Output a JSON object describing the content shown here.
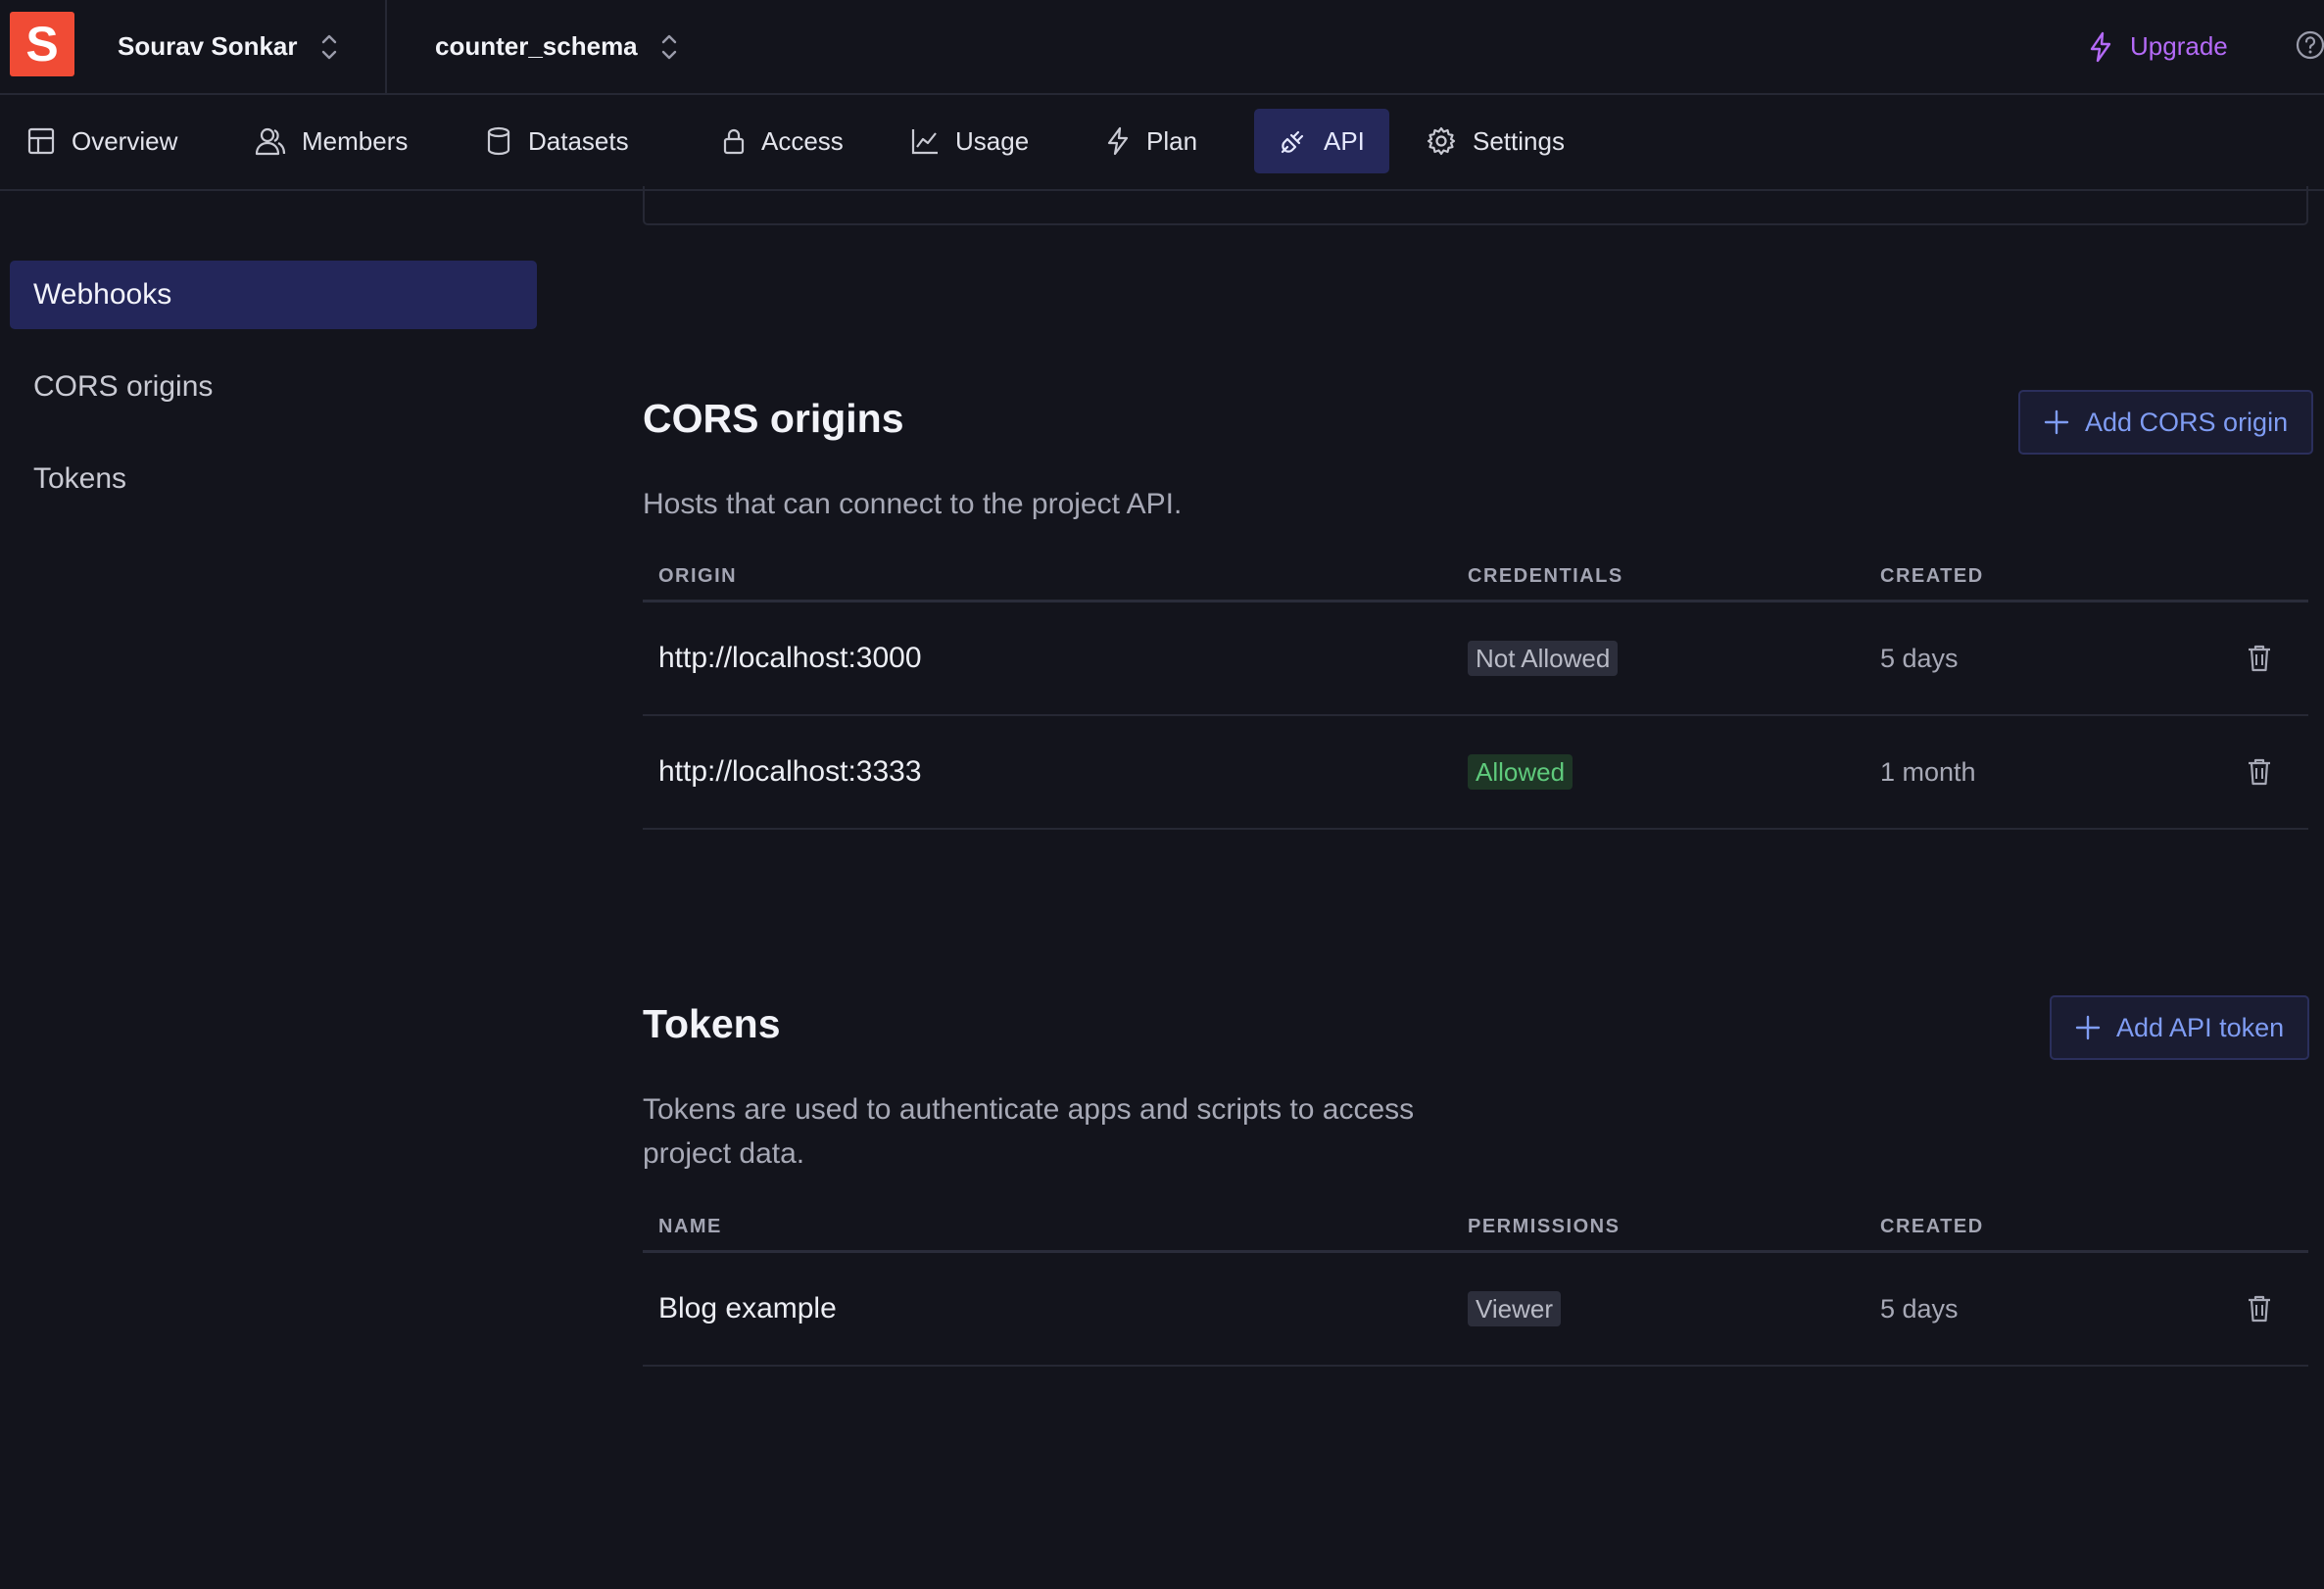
{
  "app": {
    "logo_letter": "S",
    "user_name": "Sourav Sonkar",
    "project_name": "counter_schema",
    "upgrade_label": "Upgrade"
  },
  "tabs": [
    {
      "label": "Overview",
      "icon": "grid-icon"
    },
    {
      "label": "Members",
      "icon": "users-icon"
    },
    {
      "label": "Datasets",
      "icon": "database-icon"
    },
    {
      "label": "Access",
      "icon": "lock-icon"
    },
    {
      "label": "Usage",
      "icon": "chart-icon"
    },
    {
      "label": "Plan",
      "icon": "bolt-icon"
    },
    {
      "label": "API",
      "icon": "plug-icon",
      "active": true
    },
    {
      "label": "Settings",
      "icon": "gear-icon"
    }
  ],
  "sidenav": {
    "items": [
      {
        "label": "Webhooks",
        "active": true
      },
      {
        "label": "CORS origins"
      },
      {
        "label": "Tokens"
      }
    ]
  },
  "cors": {
    "title": "CORS origins",
    "description": "Hosts that can connect to the project API.",
    "add_label": "Add CORS origin",
    "columns": [
      "ORIGIN",
      "CREDENTIALS",
      "CREATED"
    ],
    "rows": [
      {
        "origin": "http://localhost:3000",
        "credentials": "Not Allowed",
        "created": "5 days"
      },
      {
        "origin": "http://localhost:3333",
        "credentials": "Allowed",
        "created": "1 month"
      }
    ]
  },
  "tokens": {
    "title": "Tokens",
    "description_line1": "Tokens are used to authenticate apps and scripts to access",
    "description_line2": "project data.",
    "add_label": "Add API token",
    "columns": [
      "NAME",
      "PERMISSIONS",
      "CREATED"
    ],
    "rows": [
      {
        "name": "Blog example",
        "permissions": "Viewer",
        "created": "5 days"
      }
    ]
  },
  "colors": {
    "background": "#13141c",
    "logo": "#f04b35",
    "upgrade": "#b46af7",
    "accent_active": "#25285a",
    "link_blue": "#7f9cf3",
    "allowed_green": "#5fca7c"
  }
}
